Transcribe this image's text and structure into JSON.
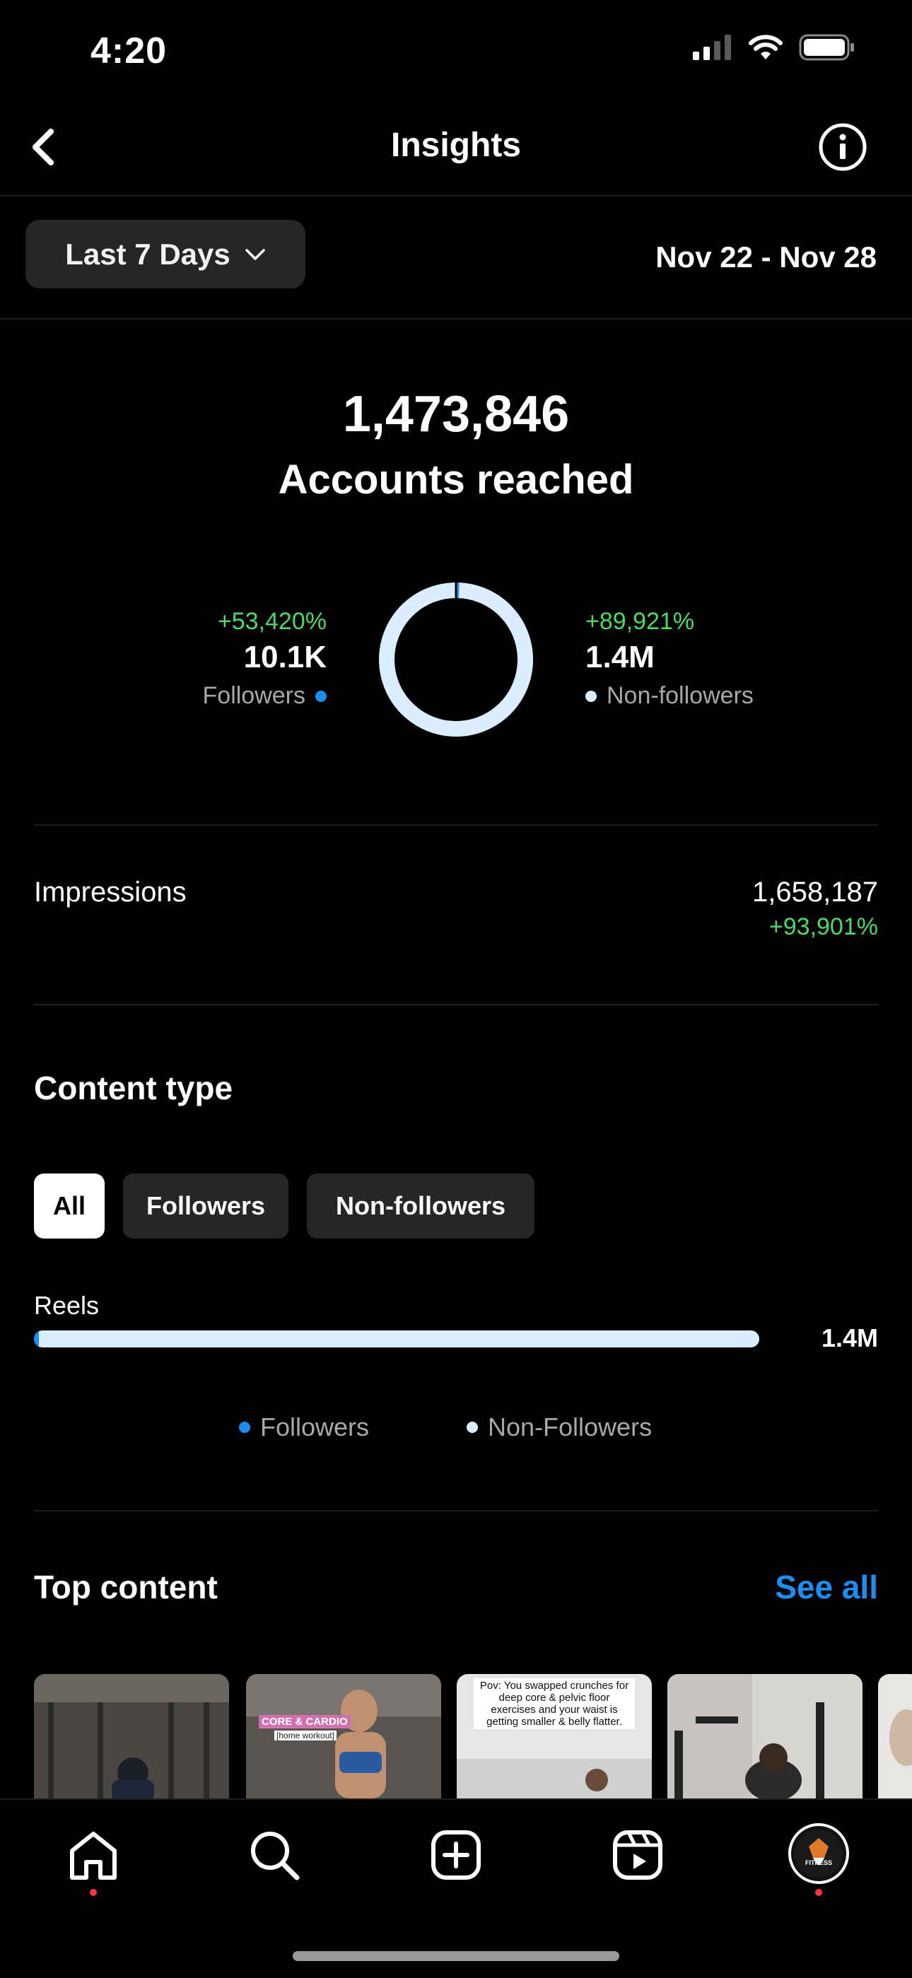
{
  "status_bar": {
    "time": "4:20"
  },
  "header": {
    "title": "Insights"
  },
  "range": {
    "selected": "Last 7 Days",
    "dates": "Nov 22 - Nov 28"
  },
  "reach": {
    "value": "1,473,846",
    "label": "Accounts reached",
    "followers": {
      "pct": "+53,420%",
      "value": "10.1K",
      "label": "Followers",
      "share": 0.007
    },
    "non_followers": {
      "pct": "+89,921%",
      "value": "1.4M",
      "label": "Non-followers",
      "share": 0.993
    }
  },
  "impressions": {
    "label": "Impressions",
    "value": "1,658,187",
    "pct": "+93,901%"
  },
  "content_type": {
    "title": "Content type",
    "filters": [
      {
        "label": "All",
        "active": true
      },
      {
        "label": "Followers",
        "active": false
      },
      {
        "label": "Non-followers",
        "active": false
      }
    ],
    "bar": {
      "label": "Reels",
      "value": "1.4M",
      "followers_share": 0.007
    },
    "legend": {
      "followers": "Followers",
      "non_followers": "Non-Followers"
    }
  },
  "top_content": {
    "title": "Top content",
    "see_all": "See all",
    "thumbnails": [
      {
        "overlay": ""
      },
      {
        "overlay": "CORE & CARDIO",
        "overlay2": "[home workout]"
      },
      {
        "overlay": "Pov: You swapped crunches for deep core & pelvic floor exercises and your waist is getting smaller & belly flatter."
      },
      {
        "overlay": ""
      }
    ]
  },
  "tab_bar": {
    "profile_badge": "FITNESS"
  },
  "colors": {
    "accent_blue": "#1b8ef0",
    "positive_green": "#4cd964",
    "non_follower_light": "#dbeeff",
    "notification_red": "#ff3040"
  }
}
